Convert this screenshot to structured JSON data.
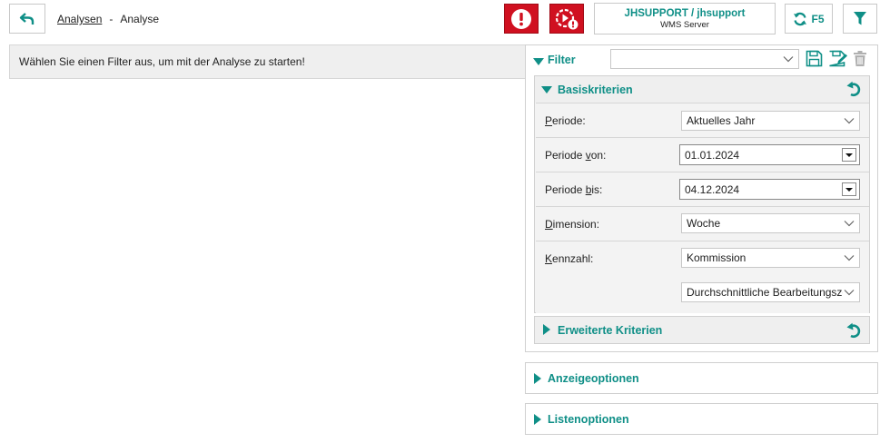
{
  "header": {
    "breadcrumb_link": "Analysen",
    "breadcrumb_sep": "-",
    "breadcrumb_current": "Analyse",
    "user": "JHSUPPORT / jhsupport",
    "server": "WMS Server",
    "refresh_label": "F5"
  },
  "info": {
    "message": "Wählen Sie einen Filter aus, um mit der Analyse zu starten!"
  },
  "filter": {
    "title": "Filter",
    "selected": ""
  },
  "basis": {
    "title": "Basiskriterien",
    "periode_label_u": "P",
    "periode_label_rest": "eriode:",
    "periode_value": "Aktuelles Jahr",
    "von_label_pre": "Periode ",
    "von_label_u": "v",
    "von_label_post": "on:",
    "von_value": "01.01.2024",
    "bis_label_pre": "Periode ",
    "bis_label_u": "b",
    "bis_label_post": "is:",
    "bis_value": "04.12.2024",
    "dimension_label_u": "D",
    "dimension_label_rest": "imension:",
    "dimension_value": "Woche",
    "kennzahl_label_u": "K",
    "kennzahl_label_rest": "ennzahl:",
    "kennzahl_value": "Kommission",
    "kennzahl_value2": "Durchschnittliche Bearbeitungszeit"
  },
  "erweitert": {
    "title": "Erweiterte Kriterien"
  },
  "anzeige": {
    "title": "Anzeigeoptionen"
  },
  "liste": {
    "title": "Listenoptionen"
  },
  "colors": {
    "teal": "#0f8f87",
    "red": "#d01020"
  }
}
